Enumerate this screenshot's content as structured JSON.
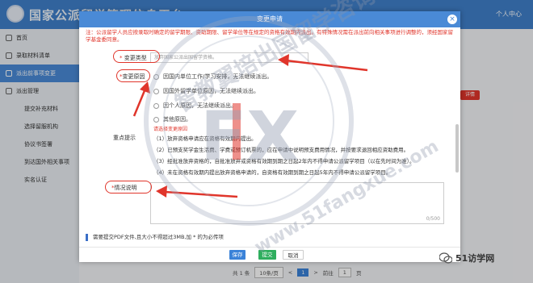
{
  "app": {
    "title": "国家公派留学管理信息平台",
    "user_menu": "个人中心"
  },
  "sidebar": {
    "items": [
      {
        "label": "首页",
        "level": "main"
      },
      {
        "label": "录取材料清单",
        "level": "main"
      },
      {
        "label": "派出前事项变更",
        "level": "main",
        "active": true
      },
      {
        "label": "派出管理",
        "level": "main"
      },
      {
        "label": "提交补充材料",
        "level": "sub"
      },
      {
        "label": "选择留服机构",
        "level": "sub"
      },
      {
        "label": "协议书签署",
        "level": "sub"
      },
      {
        "label": "到达国外相关事项",
        "level": "sub"
      },
      {
        "label": "实名认证",
        "level": "sub"
      }
    ]
  },
  "background": {
    "action_button": "详情"
  },
  "pager": {
    "total": "共 1 条",
    "page_size": "10条/页",
    "prev": "<",
    "current": "1",
    "next": ">",
    "goto_label": "前往",
    "goto_value": "1",
    "page_unit": "页"
  },
  "modal": {
    "title": "变更申请",
    "close": "×",
    "notice": "注：公派留学人员应按录取时确定的留学期限、资助期限、留学单位等在规定的资格有效期内派出。有特殊情况需在派出前向相关事项进行调整的，须经国家留学基金委同意。",
    "type_label": "变更类型",
    "type_required": "*",
    "type_placeholder": "放弃国家公派出国留学资格。",
    "reason_label": "变更原因",
    "reason_required": "*",
    "reasons": [
      "因国内单位工作/学习安排，无法继续派出。",
      "因国外留学单位原因，无法继续派出。",
      "因个人原因，无法继续派出。",
      "其他原因。"
    ],
    "reason_tip": "请选择变更原因",
    "points_label": "重点提示",
    "points": [
      "（1）放弃资格申请应在资格有效期内提出。",
      "（2）已预支奖学金生活费、学费或预订机票的，应在申请中说明预支费用情况，并按要求退回相应资助费用。",
      "（3）经批准放弃资格的，自批准放弃或资格有效期到期之日起2年内不得申请公派留学项目（以在先时间为准）。",
      "（4）未在资格有效期内提出放弃资格申请的，自资格有效期到期之日起5年内不得申请公派留学项目。"
    ],
    "desc_label": "情况说明",
    "desc_required": "*",
    "desc_counter": "0/500",
    "pdf_note": "需要提交PDF文件,且大小不得超过3MB,加 * 的为必传项",
    "buttons": {
      "save": "保存",
      "submit": "提交",
      "cancel": "取消"
    }
  },
  "watermark": {
    "stamp_text": "智教翼培出国留学咨询",
    "fx": "FX",
    "url": "www.51fangxue.com"
  },
  "brand": {
    "name": "51访学网"
  },
  "colors": {
    "primary": "#4a8ad6",
    "danger": "#e0352b",
    "success": "#2fae5e"
  }
}
